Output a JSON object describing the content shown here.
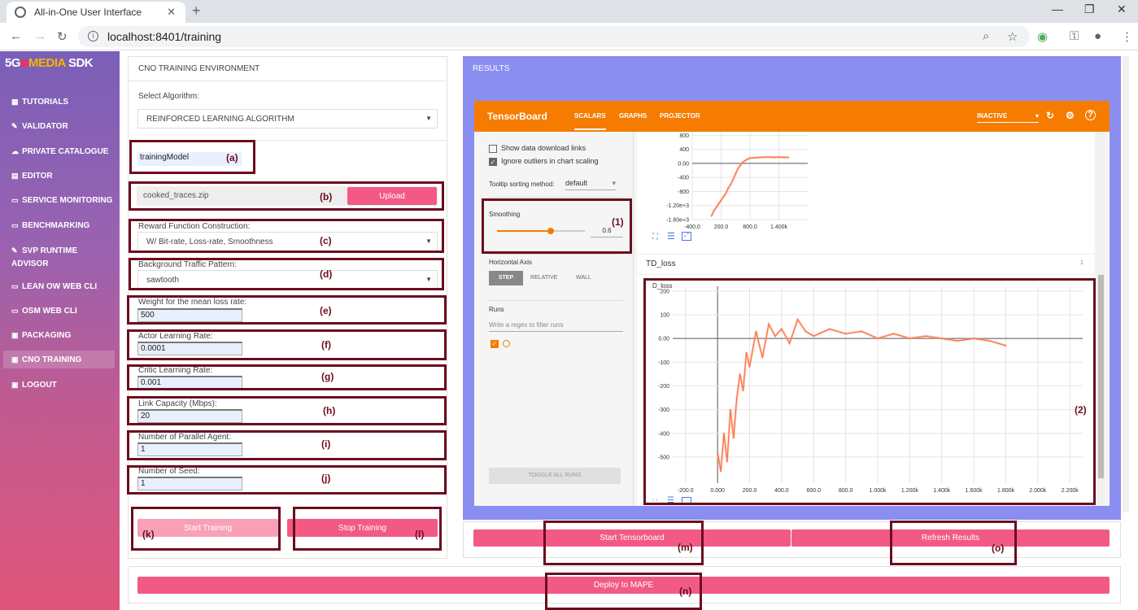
{
  "browser": {
    "tab_title": "All-in-One User Interface",
    "url": "localhost:8401/training"
  },
  "sidebar": {
    "logo_5g": "5G",
    "logo_media": "MEDIA",
    "logo_sdk": "SDK",
    "items": [
      {
        "label": "TUTORIALS",
        "icon": "grid-icon"
      },
      {
        "label": "VALIDATOR",
        "icon": "wrench-icon"
      },
      {
        "label": "PRIVATE CATALOGUE",
        "icon": "cloud-icon"
      },
      {
        "label": "EDITOR",
        "icon": "edit-icon"
      },
      {
        "label": "SERVICE MONITORING",
        "icon": "monitor-icon"
      },
      {
        "label": "BENCHMARKING",
        "icon": "monitor-icon"
      },
      {
        "label": "SVP RUNTIME ADVISOR",
        "icon": "wrench-icon"
      },
      {
        "label": "LEAN OW WEB CLI",
        "icon": "monitor-icon"
      },
      {
        "label": "OSM WEB CLI",
        "icon": "monitor-icon"
      },
      {
        "label": "PACKAGING",
        "icon": "box-icon"
      },
      {
        "label": "CNO TRAINING",
        "icon": "box-icon",
        "active": true
      },
      {
        "label": "LOGOUT",
        "icon": "logout-icon"
      }
    ]
  },
  "training": {
    "header": "CNO TRAINING ENVIRONMENT",
    "select_algorithm_label": "Select Algorithm:",
    "algorithm": "REINFORCED LEARNING ALGORITHM",
    "model_name": "trainingModel",
    "trace_file": "cooked_traces.zip",
    "upload_label": "Upload",
    "reward_label": "Reward Function Construction:",
    "reward_value": "W/ Bit-rate, Loss-rate, Smoothness",
    "traffic_label": "Background Traffic Pattern:",
    "traffic_value": "sawtooth",
    "weight_label": "Weight for the mean loss rate:",
    "weight_value": "500",
    "actor_label": "Actor Learning Rate:",
    "actor_value": "0.0001",
    "critic_label": "Critic Learning Rate:",
    "critic_value": "0.001",
    "link_label": "Link Capacity (Mbps):",
    "link_value": "20",
    "agents_label": "Number of Parallel Agent:",
    "agents_value": "1",
    "seed_label": "Number of Seed:",
    "seed_value": "1",
    "start_label": "Start Training",
    "stop_label": "Stop Training"
  },
  "annotations": {
    "a": "(a)",
    "b": "(b)",
    "c": "(c)",
    "d": "(d)",
    "e": "(e)",
    "f": "(f)",
    "g": "(g)",
    "h": "(h)",
    "i": "(i)",
    "j": "(j)",
    "k": "(k)",
    "l": "(l)",
    "m": "(m)",
    "n": "(n)",
    "o": "(o)",
    "one": "(1)",
    "two": "(2)"
  },
  "results": {
    "header": "RESULTS",
    "start_tensorboard": "Start Tensorboard",
    "refresh_results": "Refresh Results",
    "deploy": "Deploy to MAPE"
  },
  "tensorboard": {
    "title": "TensorBoard",
    "nav": [
      "SCALARS",
      "GRAPHS",
      "PROJECTOR"
    ],
    "status": "INACTIVE",
    "show_download": "Show data download links",
    "ignore_outliers": "Ignore outliers in chart scaling",
    "tooltip_label": "Tooltip sorting method:",
    "tooltip_value": "default",
    "smoothing_label": "Smoothing",
    "smoothing_value": "0.6",
    "horizontal_axis": "Horizontal Axis",
    "axis_options": [
      "STEP",
      "RELATIVE",
      "WALL"
    ],
    "runs_label": "Runs",
    "runs_filter": "Write a regex to filter runs",
    "toggle_all": "TOGGLE ALL RUNS",
    "card_title": "TD_loss",
    "card_count": "1",
    "chart_title": "D_loss"
  },
  "chart_data": [
    {
      "type": "line",
      "title": "",
      "x_ticks": [
        "-400.0",
        "200.0",
        "800.0",
        "1.400k"
      ],
      "y_ticks": [
        "800",
        "400",
        "0.00",
        "-400",
        "-800",
        "-1.20e+3",
        "-1.60e+3"
      ],
      "xlim": [
        -400,
        2000
      ],
      "ylim": [
        -1600,
        900
      ],
      "series": [
        {
          "x": [
            0,
            50,
            100,
            150,
            200,
            250,
            300,
            350,
            400,
            450,
            500,
            550,
            600,
            650,
            700,
            750,
            800,
            900,
            1000,
            1100,
            1200,
            1300,
            1400,
            1500,
            1600
          ],
          "y": [
            -1500,
            -1350,
            -1250,
            -1150,
            -1050,
            -950,
            -850,
            -700,
            -600,
            -450,
            -300,
            -150,
            -50,
            30,
            80,
            120,
            150,
            160,
            170,
            180,
            180,
            170,
            180,
            170,
            170
          ]
        }
      ]
    },
    {
      "type": "line",
      "title": "D_loss",
      "x_ticks": [
        "-200.0",
        "0.000",
        "200.0",
        "400.0",
        "600.0",
        "800.0",
        "1.000k",
        "1.200k",
        "1.400k",
        "1.600k",
        "1.800k",
        "2.000k",
        "2.200k"
      ],
      "y_ticks": [
        "200",
        "100",
        "0.00",
        "-100",
        "-200",
        "-300",
        "-400",
        "-500"
      ],
      "xlim": [
        -280,
        2280
      ],
      "ylim": [
        -610,
        220
      ],
      "series": [
        {
          "x": [
            0,
            20,
            40,
            60,
            80,
            100,
            120,
            140,
            160,
            180,
            200,
            240,
            280,
            320,
            360,
            400,
            450,
            500,
            550,
            600,
            700,
            800,
            900,
            1000,
            1100,
            1200,
            1300,
            1400,
            1500,
            1600,
            1700,
            1800
          ],
          "y": [
            -480,
            -560,
            -400,
            -520,
            -300,
            -420,
            -250,
            -150,
            -220,
            -60,
            -120,
            30,
            -80,
            60,
            10,
            40,
            -20,
            80,
            30,
            10,
            40,
            20,
            30,
            0,
            20,
            0,
            10,
            0,
            -10,
            0,
            -10,
            -30
          ]
        }
      ]
    }
  ]
}
